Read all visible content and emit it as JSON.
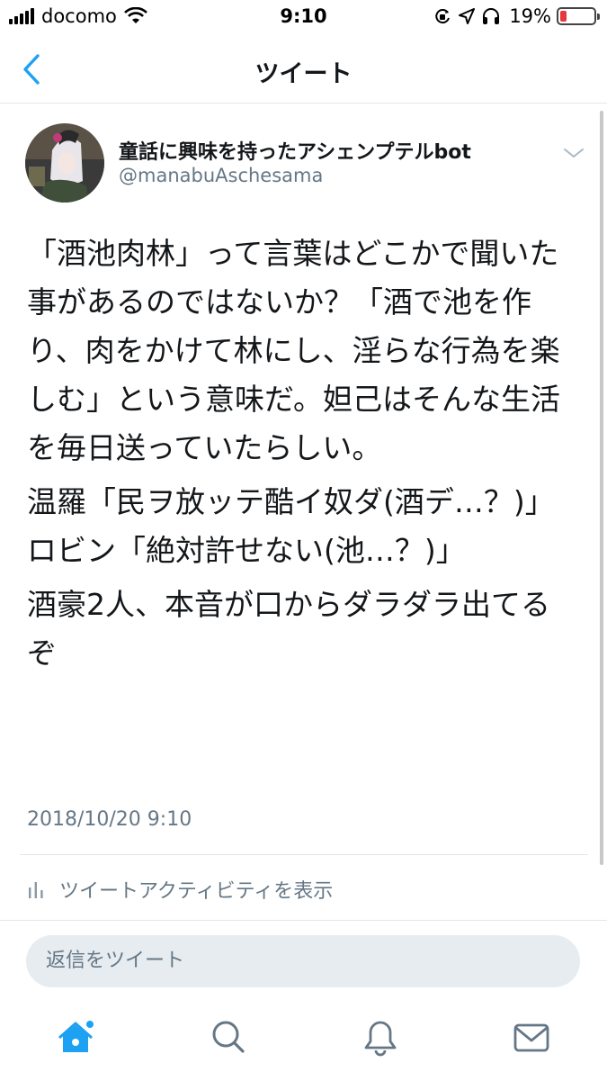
{
  "status_bar": {
    "carrier": "docomo",
    "time": "9:10",
    "battery_percent": "19%",
    "battery_level": 0.19,
    "icons": [
      "signal-icon",
      "wifi-icon",
      "orientation-lock-icon",
      "location-icon",
      "headphones-icon",
      "battery-icon"
    ]
  },
  "nav": {
    "title": "ツイート",
    "back_icon": "chevron-left-icon"
  },
  "tweet": {
    "user_name": "童話に興味を持ったアシェンプテルbot",
    "handle": "@manabuAschesama",
    "paragraphs": [
      "「酒池肉林」って言葉はどこかで聞いた事があるのではないか？「酒で池を作り、肉をかけて林にし、淫らな行為を楽しむ」という意味だ。妲己はそんな生活を毎日送っていたらしい。",
      "温羅「民ヲ放ッテ酷イ奴ダ(酒デ…？)」\nロビン「絶対許せない(池…？)」",
      "酒豪2人、本音が口からダラダラ出てるぞ"
    ],
    "timestamp": "2018/10/20 9:10",
    "activity_label": "ツイートアクティビティを表示"
  },
  "reply": {
    "placeholder": "返信をツイート"
  },
  "tab_bar": {
    "items": [
      "home-icon",
      "search-icon",
      "notifications-icon",
      "messages-icon"
    ]
  },
  "colors": {
    "accent": "#1da1f2",
    "secondary_text": "#657786",
    "battery_low": "#e8383d"
  }
}
